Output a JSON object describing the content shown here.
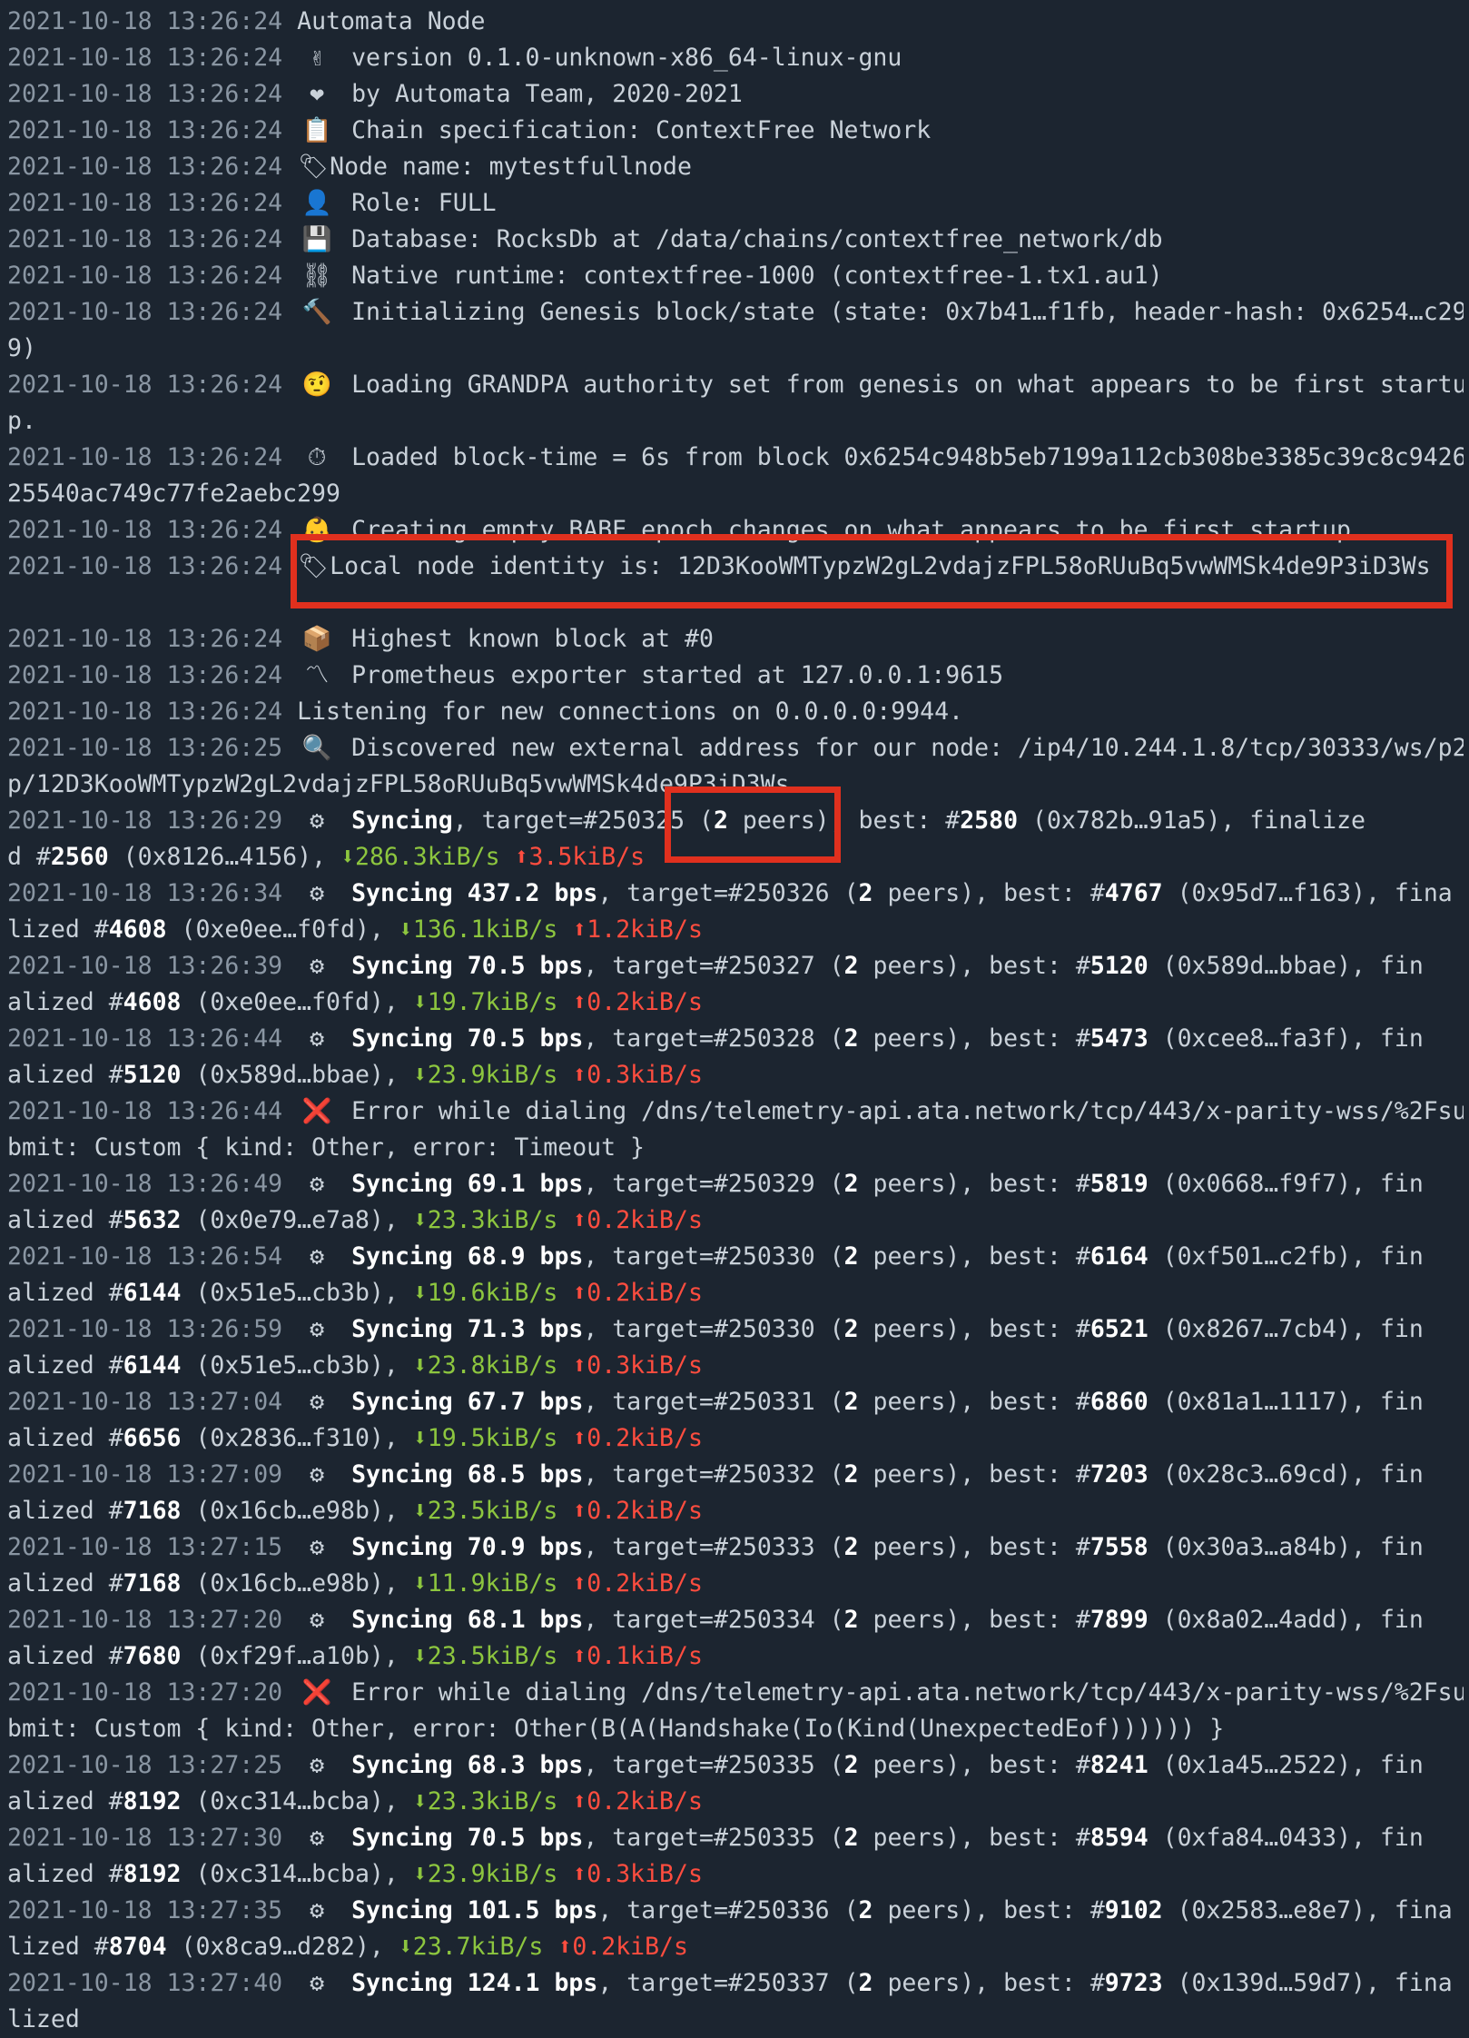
{
  "colors": {
    "background": "#1c2530",
    "timestamp": "#8a96a3",
    "text": "#c9d1d9",
    "bold": "#ffffff",
    "download": "#8dc63f",
    "upload": "#ff4d3f",
    "highlight": "#e0301e"
  },
  "lines": [
    {
      "ts": "2021-10-18 13:26:24",
      "msg": "Automata Node"
    },
    {
      "ts": "2021-10-18 13:26:24",
      "icon": "victory-hand-icon",
      "glyph": "✌",
      "msg": "version 0.1.0-unknown-x86_64-linux-gnu"
    },
    {
      "ts": "2021-10-18 13:26:24",
      "icon": "heart-icon",
      "glyph": "❤",
      "msg": "by Automata Team, 2020-2021"
    },
    {
      "ts": "2021-10-18 13:26:24",
      "icon": "clipboard-icon",
      "glyph": "📋",
      "msg": "Chain specification: ContextFree Network"
    },
    {
      "ts": "2021-10-18 13:26:24",
      "icon": "label-tag-icon",
      "glyph": "🏷",
      "msg": "Node name: mytestfullnode"
    },
    {
      "ts": "2021-10-18 13:26:24",
      "icon": "user-icon",
      "glyph": "👤",
      "msg": "Role: FULL"
    },
    {
      "ts": "2021-10-18 13:26:24",
      "icon": "floppy-disk-icon",
      "glyph": "💾",
      "msg": "Database: RocksDb at /data/chains/contextfree_network/db"
    },
    {
      "ts": "2021-10-18 13:26:24",
      "icon": "chain-link-icon",
      "glyph": "⛓",
      "msg": "Native runtime: contextfree-1000 (contextfree-1.tx1.au1)"
    },
    {
      "ts": "2021-10-18 13:26:24",
      "icon": "hammer-icon",
      "glyph": "🔨",
      "msg": "Initializing Genesis block/state (state: 0x7b41…f1fb, header-hash: 0x6254…c29"
    },
    {
      "cont": "9)"
    },
    {
      "ts": "2021-10-18 13:26:24",
      "icon": "face-icon",
      "glyph": "🤨",
      "msg": "Loading GRANDPA authority set from genesis on what appears to be first startu"
    },
    {
      "cont": "p."
    },
    {
      "ts": "2021-10-18 13:26:24",
      "icon": "stopwatch-icon",
      "glyph": "⏱",
      "msg": "Loaded block-time = 6s from block 0x6254c948b5eb7199a112cb308be3385c39c8c9426"
    },
    {
      "cont": "25540ac749c77fe2aebc299"
    },
    {
      "ts": "2021-10-18 13:26:24",
      "icon": "baby-chick-icon",
      "glyph": "👶",
      "msg": "Creating empty BABE epoch changes on what appears to be first startup"
    },
    {
      "ts": "2021-10-18 13:26:24",
      "icon": "label-tag-icon",
      "glyph": "🏷",
      "msg": "Local node identity is: 12D3KooWMTypzW2gL2vdajzFPL58oRUuBq5vwWMSk4de9P3iD3Ws"
    },
    {
      "cont": ""
    },
    {
      "ts": "2021-10-18 13:26:24",
      "icon": "package-icon",
      "glyph": "📦",
      "msg": "Highest known block at #0"
    },
    {
      "ts": "2021-10-18 13:26:24",
      "icon": "prometheus-icon",
      "glyph": "〽",
      "msg": "Prometheus exporter started at 127.0.0.1:9615"
    },
    {
      "ts": "2021-10-18 13:26:24",
      "msg": "Listening for new connections on 0.0.0.0:9944."
    },
    {
      "ts": "2021-10-18 13:26:25",
      "icon": "magnifier-icon",
      "glyph": "🔍",
      "msg": "Discovered new external address for our node: /ip4/10.244.1.8/tcp/30333/ws/p2"
    },
    {
      "cont": "p/12D3KooWMTypzW2gL2vdajzFPL58oRUuBq5vwWMSk4de9P3iD3Ws"
    },
    {
      "ts": "2021-10-18 13:26:29",
      "icon": "gear-icon",
      "glyph": "⚙",
      "sync": {
        "label": "Syncing",
        "bps": "",
        "target": "250325",
        "peers": "2",
        "best": "2580",
        "besthash": "0x782b…91a5",
        "fin_word": "finalized",
        "fin": "2560",
        "finhash": "0x8126…4156",
        "down": "286.3kiB/s",
        "up": "3.5kiB/s",
        "split": 1
      }
    },
    {
      "ts": "2021-10-18 13:26:34",
      "icon": "gear-icon",
      "glyph": "⚙",
      "sync": {
        "label": "Syncing",
        "bps": "437.2 bps",
        "target": "250326",
        "peers": "2",
        "best": "4767",
        "besthash": "0x95d7…f163",
        "fin_word": "finalized",
        "fin": "4608",
        "finhash": "0xe0ee…f0fd",
        "down": "136.1kiB/s",
        "up": "1.2kiB/s",
        "split": 5
      }
    },
    {
      "ts": "2021-10-18 13:26:39",
      "icon": "gear-icon",
      "glyph": "⚙",
      "sync": {
        "label": "Syncing",
        "bps": "70.5 bps",
        "target": "250327",
        "peers": "2",
        "best": "5120",
        "besthash": "0x589d…bbae",
        "fin_word": "finalized",
        "fin": "4608",
        "finhash": "0xe0ee…f0fd",
        "down": "19.7kiB/s",
        "up": "0.2kiB/s",
        "split": 6
      }
    },
    {
      "ts": "2021-10-18 13:26:44",
      "icon": "gear-icon",
      "glyph": "⚙",
      "sync": {
        "label": "Syncing",
        "bps": "70.5 bps",
        "target": "250328",
        "peers": "2",
        "best": "5473",
        "besthash": "0xcee8…fa3f",
        "fin_word": "finalized",
        "fin": "5120",
        "finhash": "0x589d…bbae",
        "down": "23.9kiB/s",
        "up": "0.3kiB/s",
        "split": 6
      }
    },
    {
      "ts": "2021-10-18 13:26:44",
      "icon": "error-x-icon",
      "glyph": "❌",
      "msg": "Error while dialing /dns/telemetry-api.ata.network/tcp/443/x-parity-wss/%2Fsu"
    },
    {
      "cont": "bmit: Custom { kind: Other, error: Timeout }"
    },
    {
      "ts": "2021-10-18 13:26:49",
      "icon": "gear-icon",
      "glyph": "⚙",
      "sync": {
        "label": "Syncing",
        "bps": "69.1 bps",
        "target": "250329",
        "peers": "2",
        "best": "5819",
        "besthash": "0x0668…f9f7",
        "fin_word": "finalized",
        "fin": "5632",
        "finhash": "0x0e79…e7a8",
        "down": "23.3kiB/s",
        "up": "0.2kiB/s",
        "split": 6
      }
    },
    {
      "ts": "2021-10-18 13:26:54",
      "icon": "gear-icon",
      "glyph": "⚙",
      "sync": {
        "label": "Syncing",
        "bps": "68.9 bps",
        "target": "250330",
        "peers": "2",
        "best": "6164",
        "besthash": "0xf501…c2fb",
        "fin_word": "finalized",
        "fin": "6144",
        "finhash": "0x51e5…cb3b",
        "down": "19.6kiB/s",
        "up": "0.2kiB/s",
        "split": 6
      }
    },
    {
      "ts": "2021-10-18 13:26:59",
      "icon": "gear-icon",
      "glyph": "⚙",
      "sync": {
        "label": "Syncing",
        "bps": "71.3 bps",
        "target": "250330",
        "peers": "2",
        "best": "6521",
        "besthash": "0x8267…7cb4",
        "fin_word": "finalized",
        "fin": "6144",
        "finhash": "0x51e5…cb3b",
        "down": "23.8kiB/s",
        "up": "0.3kiB/s",
        "split": 6
      }
    },
    {
      "ts": "2021-10-18 13:27:04",
      "icon": "gear-icon",
      "glyph": "⚙",
      "sync": {
        "label": "Syncing",
        "bps": "67.7 bps",
        "target": "250331",
        "peers": "2",
        "best": "6860",
        "besthash": "0x81a1…1117",
        "fin_word": "finalized",
        "fin": "6656",
        "finhash": "0x2836…f310",
        "down": "19.5kiB/s",
        "up": "0.2kiB/s",
        "split": 6
      }
    },
    {
      "ts": "2021-10-18 13:27:09",
      "icon": "gear-icon",
      "glyph": "⚙",
      "sync": {
        "label": "Syncing",
        "bps": "68.5 bps",
        "target": "250332",
        "peers": "2",
        "best": "7203",
        "besthash": "0x28c3…69cd",
        "fin_word": "finalized",
        "fin": "7168",
        "finhash": "0x16cb…e98b",
        "down": "23.5kiB/s",
        "up": "0.2kiB/s",
        "split": 6
      }
    },
    {
      "ts": "2021-10-18 13:27:15",
      "icon": "gear-icon",
      "glyph": "⚙",
      "sync": {
        "label": "Syncing",
        "bps": "70.9 bps",
        "target": "250333",
        "peers": "2",
        "best": "7558",
        "besthash": "0x30a3…a84b",
        "fin_word": "finalized",
        "fin": "7168",
        "finhash": "0x16cb…e98b",
        "down": "11.9kiB/s",
        "up": "0.2kiB/s",
        "split": 6
      }
    },
    {
      "ts": "2021-10-18 13:27:20",
      "icon": "gear-icon",
      "glyph": "⚙",
      "sync": {
        "label": "Syncing",
        "bps": "68.1 bps",
        "target": "250334",
        "peers": "2",
        "best": "7899",
        "besthash": "0x8a02…4add",
        "fin_word": "finalized",
        "fin": "7680",
        "finhash": "0xf29f…a10b",
        "down": "23.5kiB/s",
        "up": "0.1kiB/s",
        "split": 6
      }
    },
    {
      "ts": "2021-10-18 13:27:20",
      "icon": "error-x-icon",
      "glyph": "❌",
      "msg": "Error while dialing /dns/telemetry-api.ata.network/tcp/443/x-parity-wss/%2Fsu"
    },
    {
      "cont": "bmit: Custom { kind: Other, error: Other(B(A(Handshake(Io(Kind(UnexpectedEof)))))) }"
    },
    {
      "ts": "2021-10-18 13:27:25",
      "icon": "gear-icon",
      "glyph": "⚙",
      "sync": {
        "label": "Syncing",
        "bps": "68.3 bps",
        "target": "250335",
        "peers": "2",
        "best": "8241",
        "besthash": "0x1a45…2522",
        "fin_word": "finalized",
        "fin": "8192",
        "finhash": "0xc314…bcba",
        "down": "23.3kiB/s",
        "up": "0.2kiB/s",
        "split": 6
      }
    },
    {
      "ts": "2021-10-18 13:27:30",
      "icon": "gear-icon",
      "glyph": "⚙",
      "sync": {
        "label": "Syncing",
        "bps": "70.5 bps",
        "target": "250335",
        "peers": "2",
        "best": "8594",
        "besthash": "0xfa84…0433",
        "fin_word": "finalized",
        "fin": "8192",
        "finhash": "0xc314…bcba",
        "down": "23.9kiB/s",
        "up": "0.3kiB/s",
        "split": 6
      }
    },
    {
      "ts": "2021-10-18 13:27:35",
      "icon": "gear-icon",
      "glyph": "⚙",
      "sync": {
        "label": "Syncing",
        "bps": "101.5 bps",
        "target": "250336",
        "peers": "2",
        "best": "9102",
        "besthash": "0x2583…e8e7",
        "fin_word": "finalized",
        "fin": "8704",
        "finhash": "0x8ca9…d282",
        "down": "23.7kiB/s",
        "up": "0.2kiB/s",
        "split": 5
      }
    },
    {
      "ts": "2021-10-18 13:27:40",
      "icon": "gear-icon",
      "glyph": "⚙",
      "sync": {
        "label": "Syncing",
        "bps": "124.1 bps",
        "target": "250337",
        "peers": "2",
        "best": "9723",
        "besthash": "0x139d…59d7",
        "fin_word": "finalized",
        "fin": "",
        "finhash": "",
        "down": "",
        "up": "",
        "split": 5
      }
    }
  ]
}
